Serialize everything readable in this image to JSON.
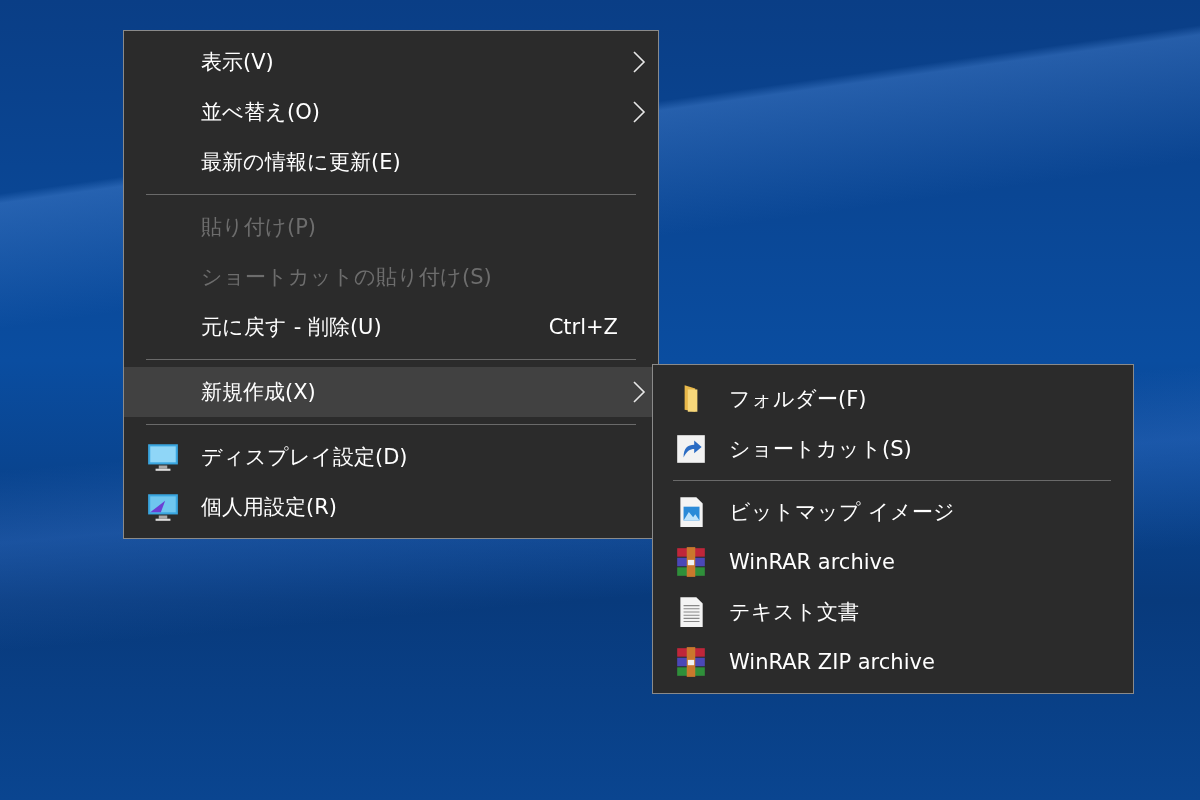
{
  "context_menu": {
    "items": [
      {
        "kind": "item",
        "label": "表示(V)",
        "submenu": true,
        "disabled": false,
        "selected": false
      },
      {
        "kind": "item",
        "label": "並べ替え(O)",
        "submenu": true,
        "disabled": false,
        "selected": false
      },
      {
        "kind": "item",
        "label": "最新の情報に更新(E)",
        "submenu": false,
        "disabled": false,
        "selected": false
      },
      {
        "kind": "separator"
      },
      {
        "kind": "item",
        "label": "貼り付け(P)",
        "submenu": false,
        "disabled": true,
        "selected": false
      },
      {
        "kind": "item",
        "label": "ショートカットの貼り付け(S)",
        "submenu": false,
        "disabled": true,
        "selected": false
      },
      {
        "kind": "item",
        "label": "元に戻す - 削除(U)",
        "shortcut": "Ctrl+Z",
        "submenu": false,
        "disabled": false,
        "selected": false
      },
      {
        "kind": "separator"
      },
      {
        "kind": "item",
        "label": "新規作成(X)",
        "submenu": true,
        "disabled": false,
        "selected": true
      },
      {
        "kind": "separator"
      },
      {
        "kind": "item",
        "label": "ディスプレイ設定(D)",
        "submenu": false,
        "disabled": false,
        "selected": false
      },
      {
        "kind": "item",
        "label": "個人用設定(R)",
        "submenu": false,
        "disabled": false,
        "selected": false
      }
    ]
  },
  "new_submenu": {
    "items": [
      {
        "kind": "item",
        "label": "フォルダー(F)"
      },
      {
        "kind": "item",
        "label": "ショートカット(S)"
      },
      {
        "kind": "separator"
      },
      {
        "kind": "item",
        "label": "ビットマップ イメージ"
      },
      {
        "kind": "item",
        "label": "WinRAR archive"
      },
      {
        "kind": "item",
        "label": "テキスト文書"
      },
      {
        "kind": "item",
        "label": "WinRAR ZIP archive"
      }
    ]
  }
}
